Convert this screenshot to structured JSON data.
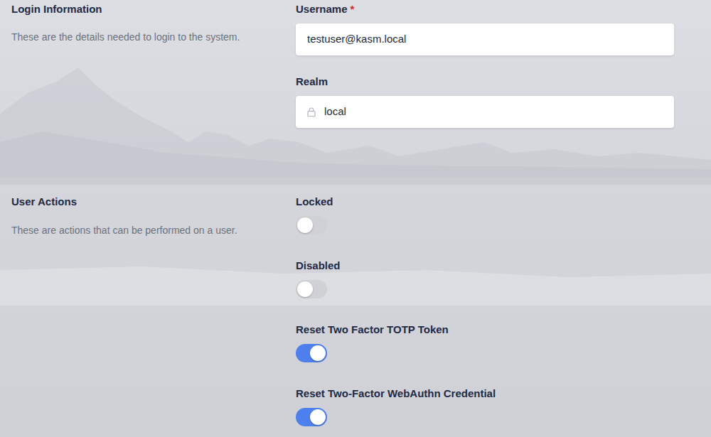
{
  "login": {
    "title": "Login Information",
    "description": "These are the details needed to login to the system.",
    "fields": [
      {
        "label": "Username",
        "required": true,
        "required_mark": "*",
        "value": "testuser@kasm.local",
        "locked": false
      },
      {
        "label": "Realm",
        "required": false,
        "value": "local",
        "locked": true
      }
    ]
  },
  "actions": {
    "title": "User Actions",
    "description": "These are actions that can be performed on a user.",
    "toggles": [
      {
        "label": "Locked",
        "on": false
      },
      {
        "label": "Disabled",
        "on": false
      },
      {
        "label": "Reset Two Factor TOTP Token",
        "on": true
      },
      {
        "label": "Reset Two-Factor WebAuthn Credential",
        "on": true
      }
    ]
  }
}
